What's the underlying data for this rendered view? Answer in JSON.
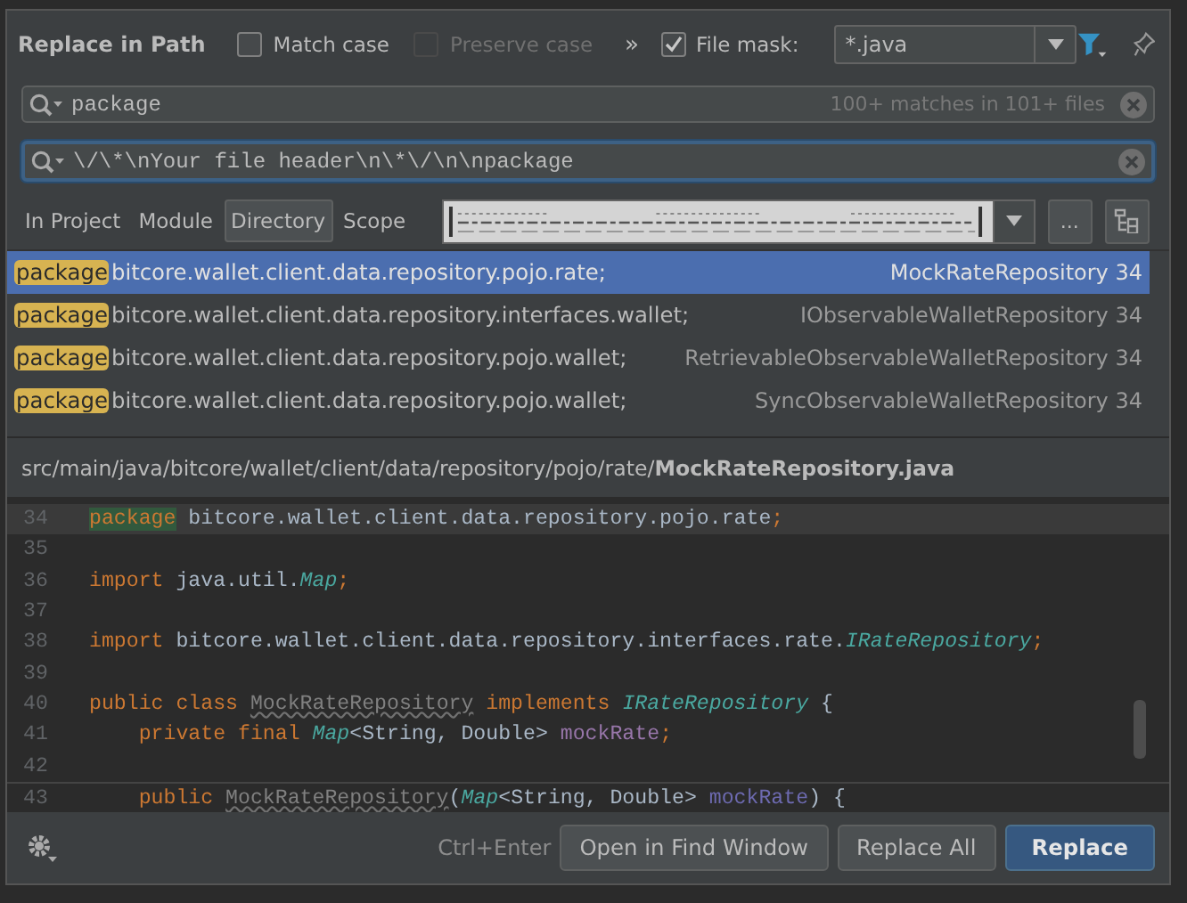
{
  "window": {
    "title": "Replace in Path"
  },
  "options": [
    {
      "kind": "checkbox",
      "label": "Match case",
      "checked": false,
      "disabled": false
    },
    {
      "kind": "checkbox",
      "label": "Preserve case",
      "checked": false,
      "disabled": true
    },
    {
      "kind": "more",
      "label": "»"
    },
    {
      "kind": "checkbox",
      "label": "File mask:",
      "checked": true,
      "disabled": false
    }
  ],
  "file_mask": {
    "value": "*.java"
  },
  "search": {
    "value": "package",
    "match_info": "100+ matches in 101+ files",
    "focused": false
  },
  "replace": {
    "value": "\\/\\*\\nYour file header\\n\\*\\/\\n\\npackage",
    "focused": true
  },
  "scope_tabs": [
    {
      "label": "In Project",
      "selected": false
    },
    {
      "label": "Module",
      "selected": false
    },
    {
      "label": "Directory",
      "selected": true
    },
    {
      "label": "Scope",
      "selected": false
    }
  ],
  "scope_more": {
    "label": "..."
  },
  "results": [
    {
      "keyword": "package",
      "text": "bitcore.wallet.client.data.repository.pojo.rate;",
      "file": "MockRateRepository",
      "line": "34",
      "selected": true
    },
    {
      "keyword": "package",
      "text": "bitcore.wallet.client.data.repository.interfaces.wallet;",
      "file": "IObservableWalletRepository",
      "line": "34",
      "selected": false
    },
    {
      "keyword": "package",
      "text": "bitcore.wallet.client.data.repository.pojo.wallet;",
      "file": "RetrievableObservableWalletRepository",
      "line": "34",
      "selected": false
    },
    {
      "keyword": "package",
      "text": "bitcore.wallet.client.data.repository.pojo.wallet;",
      "file": "SyncObservableWalletRepository",
      "line": "34",
      "selected": false
    }
  ],
  "preview": {
    "path": "src/main/java/bitcore/wallet/client/data/repository/pojo/rate/**MockRateRepository.java**",
    "lines": [
      {
        "number": "34",
        "current": true,
        "tokens": [
          {
            "kind": "match",
            "text": "package"
          },
          {
            "kind": "plain",
            "text": " bitcore.wallet.client.data.repository.pojo.rate"
          },
          {
            "kind": "keyword",
            "text": ";"
          }
        ]
      },
      {
        "number": "35",
        "current": false
      },
      {
        "number": "36",
        "current": false,
        "tokens": [
          {
            "kind": "keyword",
            "text": "import"
          },
          {
            "kind": "plain",
            "text": " java.util."
          },
          {
            "kind": "type",
            "text": "Map"
          },
          {
            "kind": "keyword",
            "text": ";"
          }
        ]
      },
      {
        "number": "37",
        "current": false
      },
      {
        "number": "38",
        "current": false,
        "tokens": [
          {
            "kind": "keyword",
            "text": "import"
          },
          {
            "kind": "plain",
            "text": " bitcore.wallet.client.data.repository.interfaces.rate."
          },
          {
            "kind": "type",
            "text": "IRateRepository"
          },
          {
            "kind": "keyword",
            "text": ";"
          }
        ]
      },
      {
        "number": "39",
        "current": false
      },
      {
        "number": "40",
        "current": false,
        "tokens": [
          {
            "kind": "keyword",
            "text": "public class "
          },
          {
            "kind": "unused",
            "text": "MockRateRepository"
          },
          {
            "kind": "keyword",
            "text": " implements "
          },
          {
            "kind": "type",
            "text": "IRateRepository"
          },
          {
            "kind": "plain",
            "text": " {"
          }
        ]
      },
      {
        "number": "41",
        "current": false,
        "tokens": [
          {
            "kind": "keyword",
            "text": "    private final "
          },
          {
            "kind": "type",
            "text": "Map"
          },
          {
            "kind": "plain",
            "text": "<String, Double> "
          },
          {
            "kind": "field",
            "text": "mockRate"
          },
          {
            "kind": "keyword",
            "text": ";"
          }
        ]
      },
      {
        "number": "42",
        "current": false
      },
      {
        "number": "43",
        "current": false,
        "tokens": [
          {
            "kind": "keyword",
            "text": "    public "
          },
          {
            "kind": "unused",
            "text": "MockRateRepository"
          },
          {
            "kind": "plain",
            "text": "("
          },
          {
            "kind": "type",
            "text": "Map"
          },
          {
            "kind": "plain",
            "text": "<String, Double> "
          },
          {
            "kind": "param",
            "text": "mockRate"
          },
          {
            "kind": "plain",
            "text": ") {"
          }
        ]
      }
    ]
  },
  "footer": {
    "shortcut": "Ctrl+Enter",
    "buttons": [
      {
        "label": "Open in Find Window",
        "default": false
      },
      {
        "label": "Replace All",
        "default": false
      },
      {
        "label": "Replace",
        "default": true
      }
    ]
  }
}
